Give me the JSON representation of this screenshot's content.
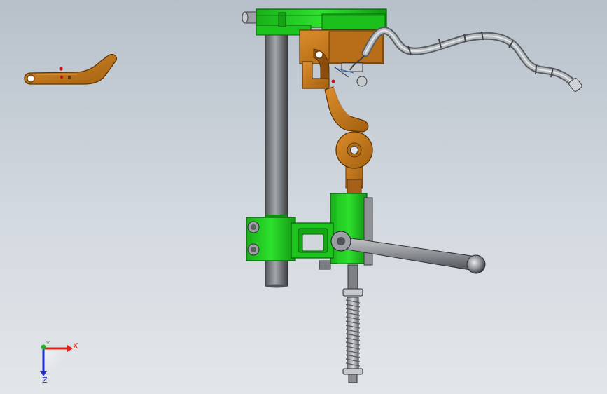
{
  "viewport": {
    "background_top": "#b7c0ca",
    "background_bottom": "#e3e6e9"
  },
  "colors": {
    "green_part": "#22d322",
    "green_dark": "#0f8f0f",
    "orange_part": "#c8781c",
    "orange_dark": "#7a4208",
    "steel": "#8c8f93",
    "steel_dark": "#4a4d52",
    "hose": "#9aa0a6"
  },
  "triad": {
    "x_label": "X",
    "y_label": "Y",
    "z_label": "Z",
    "x_color": "#e0241b",
    "y_color": "#1fb21f",
    "z_color": "#2330c8"
  }
}
